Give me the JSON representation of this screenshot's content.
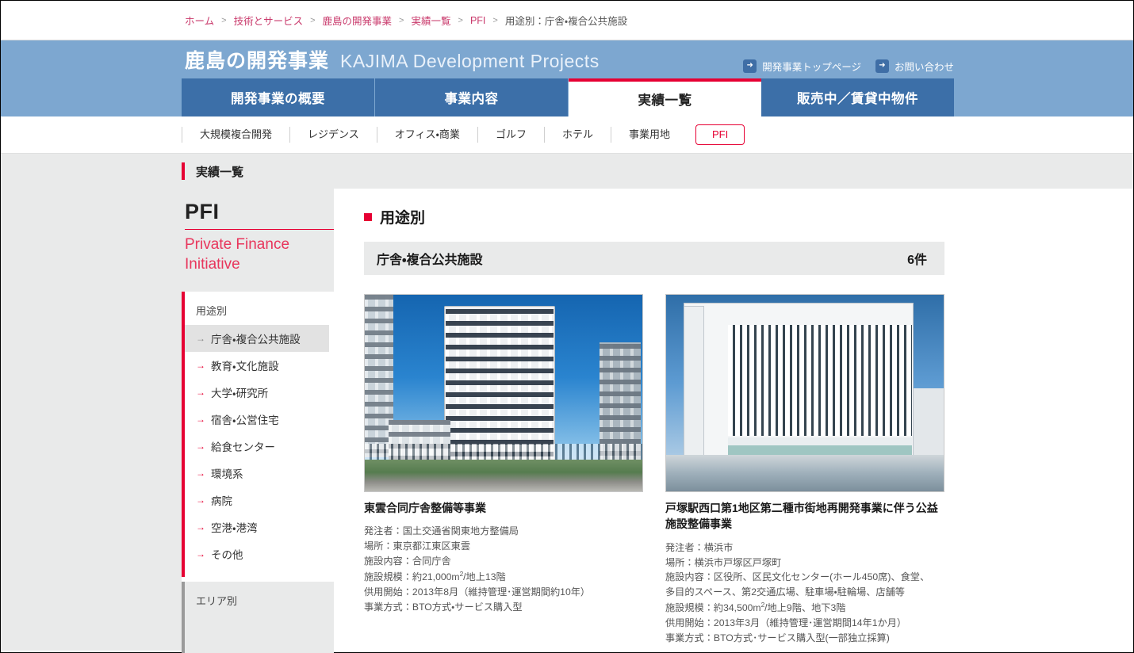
{
  "breadcrumb": {
    "items": [
      {
        "label": "ホーム",
        "current": false
      },
      {
        "label": "技術とサービス",
        "current": false
      },
      {
        "label": "鹿島の開発事業",
        "current": false
      },
      {
        "label": "実績一覧",
        "current": false
      },
      {
        "label": "PFI",
        "current": false
      },
      {
        "label": "用途別：庁舎・複合公共施設",
        "current": true
      }
    ],
    "separator": ">"
  },
  "header": {
    "title_jp": "鹿島の開発事業",
    "title_en": "KAJIMA Development Projects",
    "links": [
      {
        "label": "開発事業トップページ",
        "icon": "arrow-right-icon"
      },
      {
        "label": "お問い合わせ",
        "icon": "arrow-right-icon"
      }
    ]
  },
  "main_nav": {
    "tabs": [
      {
        "label": "開発事業の概要",
        "active": false
      },
      {
        "label": "事業内容",
        "active": false
      },
      {
        "label": "実績一覧",
        "active": true
      },
      {
        "label": "販売中／賃貸中物件",
        "active": false
      }
    ]
  },
  "sub_nav": {
    "items": [
      {
        "label": "大規模複合開発",
        "active": false
      },
      {
        "label": "レジデンス",
        "active": false
      },
      {
        "label": "オフィス・商業",
        "active": false
      },
      {
        "label": "ゴルフ",
        "active": false
      },
      {
        "label": "ホテル",
        "active": false
      },
      {
        "label": "事業用地",
        "active": false
      },
      {
        "label": "PFI",
        "active": true
      }
    ]
  },
  "section_strip": {
    "title": "実績一覧"
  },
  "sidebar": {
    "abbr": "PFI",
    "full_name": "Private Finance Initiative",
    "use_group_label": "用途別",
    "use_items": [
      {
        "label": "庁舎・複合公共施設",
        "active": true
      },
      {
        "label": "教育・文化施設",
        "active": false
      },
      {
        "label": "大学・研究所",
        "active": false
      },
      {
        "label": "宿舎・公営住宅",
        "active": false
      },
      {
        "label": "給食センター",
        "active": false
      },
      {
        "label": "環境系",
        "active": false
      },
      {
        "label": "病院",
        "active": false
      },
      {
        "label": "空港・港湾",
        "active": false
      },
      {
        "label": "その他",
        "active": false
      }
    ],
    "area_group_label": "エリア別",
    "arrow_glyph": "→"
  },
  "main": {
    "section_title": "用途別",
    "category": {
      "name": "庁舎・複合公共施設",
      "count": "6件"
    },
    "projects": [
      {
        "title": "東雲合同庁舎整備等事業",
        "photo_alt": "東雲合同庁舎の外観写真",
        "details": [
          "発注者：国土交通省関東地方整備局",
          "場所：東京都江東区東雲",
          "施設内容：合同庁舎"
        ],
        "scale_prefix": "施設規模：約21,000m",
        "scale_sup": "2",
        "scale_suffix": "/地上13階",
        "details_after": [
          "供用開始：2013年8月（維持管理･運営期間約10年）",
          "事業方式：BTO方式・サービス購入型"
        ]
      },
      {
        "title": "戸塚駅西口第1地区第二種市街地再開発事業に伴う公益施設整備事業",
        "photo_alt": "戸塚区総合庁舎の外観写真",
        "details": [
          "発注者：横浜市",
          "場所：横浜市戸塚区戸塚町",
          "施設内容：区役所、区民文化センター(ホール450席)、食堂、",
          "多目的スペース、第2交通広場、駐車場・駐輪場、店舗等"
        ],
        "scale_prefix": "施設規模：約34,500m",
        "scale_sup": "2",
        "scale_suffix": "/地上9階、地下3階",
        "details_after": [
          "供用開始：2013年3月（維持管理･運営期間14年1か月）",
          "事業方式：BTO方式･サービス購入型(一部独立採算)"
        ]
      }
    ]
  },
  "colors": {
    "accent_red": "#e60033",
    "banner_blue": "#7da7d0",
    "nav_blue": "#3c6fa8",
    "panel_gray": "#e9eaea",
    "breadcrumb_link": "#c9396b"
  }
}
